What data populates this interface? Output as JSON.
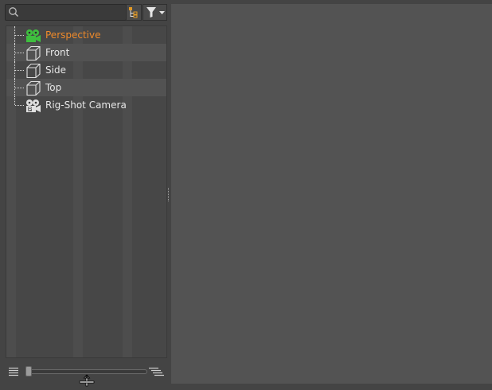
{
  "search": {
    "placeholder": "",
    "value": ""
  },
  "toolbar": {
    "hierarchy_icon": "hierarchy-filter-icon",
    "filter_icon": "funnel-dropdown-icon"
  },
  "tree": {
    "items": [
      {
        "label": "Perspective",
        "icon": "perspective-camera-icon",
        "active": true
      },
      {
        "label": "Front",
        "icon": "ortho-cube-icon",
        "active": false
      },
      {
        "label": "Side",
        "icon": "ortho-cube-icon",
        "active": false
      },
      {
        "label": "Top",
        "icon": "ortho-cube-icon",
        "active": false
      },
      {
        "label": "Rig-Shot Camera",
        "icon": "rig-camera-icon",
        "active": false
      }
    ]
  },
  "bottom": {
    "slider_value": 0.0,
    "left_icon": "list-compact-icon",
    "right_icon": "list-indent-icon"
  },
  "colors": {
    "active_label": "#ef8a2a",
    "camera_green": "#3fbf3f",
    "viewport_bg": "#535353",
    "panel_bg": "#444444"
  }
}
